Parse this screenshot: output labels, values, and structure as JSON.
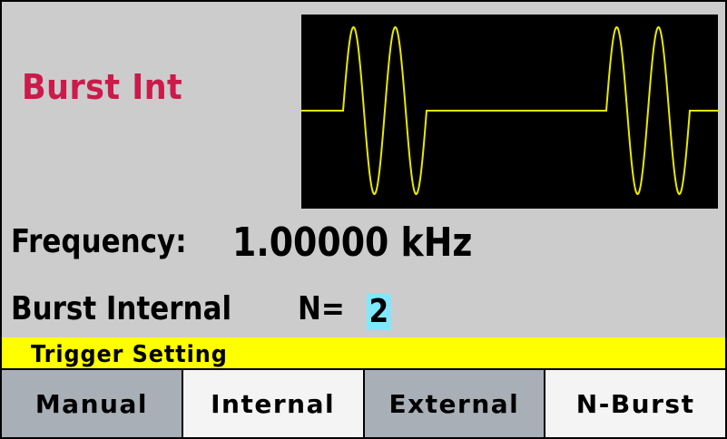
{
  "screen": {
    "mode_title": "Burst Int",
    "frequency_label": "Frequency:",
    "frequency_value": "1.00000 kHz",
    "burst_label": "Burst Internal",
    "count_prefix": "N=",
    "count_value": "2"
  },
  "waveform": {
    "type": "burst-sine",
    "cycles_per_burst": 2,
    "bursts_visible": 2,
    "trace_color": "#e8e800",
    "background_color": "#000000"
  },
  "menu": {
    "title": "Trigger Setting",
    "highlight_color": "#ffff00",
    "softkeys": [
      {
        "label": "Manual",
        "style": "dim"
      },
      {
        "label": "Internal",
        "style": "lit"
      },
      {
        "label": "External",
        "style": "dim"
      },
      {
        "label": "N-Burst",
        "style": "lit"
      }
    ]
  },
  "colors": {
    "mode_title": "#cc1a4a",
    "selected_value_bg": "#7fe8ff",
    "screen_bg": "#cccccc"
  }
}
